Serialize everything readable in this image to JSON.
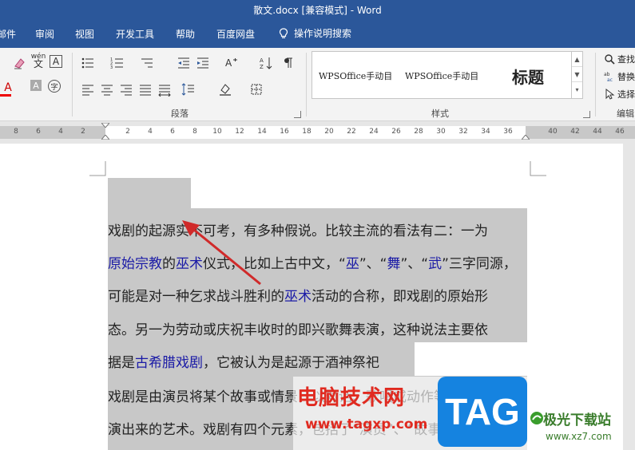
{
  "window": {
    "title": "散文.docx [兼容模式] - Word"
  },
  "tabs": [
    "邮件",
    "审阅",
    "视图",
    "开发工具",
    "帮助",
    "百度网盘"
  ],
  "tell_me": {
    "label": "操作说明搜索",
    "icon": "lightbulb-icon"
  },
  "ribbon": {
    "groups": {
      "paragraph": "段落",
      "styles": "样式",
      "editing": "编辑"
    },
    "font": {
      "phonetic_label": "wén",
      "phonetic_char": "文",
      "border_char": "A",
      "highlight_char": "A",
      "shading_char": "A",
      "enclose_char": "字"
    },
    "styles": [
      {
        "label": "WPSOffice手动目"
      },
      {
        "label": "WPSOffice手动目"
      },
      {
        "label": "标题"
      }
    ],
    "editing": {
      "find": "查找",
      "replace": "替换",
      "select": "选择"
    }
  },
  "ruler": {
    "left_numbers": [
      "8",
      "6",
      "4",
      "2"
    ],
    "numbers": [
      "2",
      "4",
      "6",
      "8",
      "10",
      "12",
      "14",
      "16",
      "18",
      "20",
      "22",
      "24",
      "26",
      "28",
      "30",
      "32",
      "34",
      "36",
      "40",
      "42",
      "44",
      "46"
    ]
  },
  "document": {
    "lines": [
      [
        {
          "t": "戏剧的起源实不可考，有多种假说。比较主流的看法有二：一为"
        }
      ],
      [
        {
          "t": "原始宗教",
          "link": true
        },
        {
          "t": "的"
        },
        {
          "t": "巫术",
          "link": true
        },
        {
          "t": "仪式，比如上古中文，“"
        },
        {
          "t": "巫",
          "link": true
        },
        {
          "t": "”、“"
        },
        {
          "t": "舞",
          "link": true
        },
        {
          "t": "”、“"
        },
        {
          "t": "武",
          "link": true
        },
        {
          "t": "”三字同源，"
        }
      ],
      [
        {
          "t": "可能是对一种乞求战斗胜利的"
        },
        {
          "t": "巫术",
          "link": true
        },
        {
          "t": "活动的合称，即戏剧的原始形"
        }
      ],
      [
        {
          "t": "态。另一为劳动或庆祝丰收时的即兴歌舞表演，这种说法主要依"
        }
      ],
      [
        {
          "t": "据是"
        },
        {
          "t": "古希腊戏剧",
          "link": true
        },
        {
          "t": "，它被认为是起源于酒神祭祀"
        }
      ],
      [
        {
          "t": "戏剧是由演员将某个故事或情景，以对话、歌唱或动作等方式表"
        }
      ],
      [
        {
          "t": "演出来的艺术。戏剧有四个元素，包括了“演员”、“故事（情境）”、"
        }
      ]
    ]
  },
  "watermark": {
    "brand": "电脑技术网",
    "url": "www.tagxp.com",
    "tag": "TAG",
    "site": "极光下载站",
    "site_url": "www.xz7.com"
  }
}
